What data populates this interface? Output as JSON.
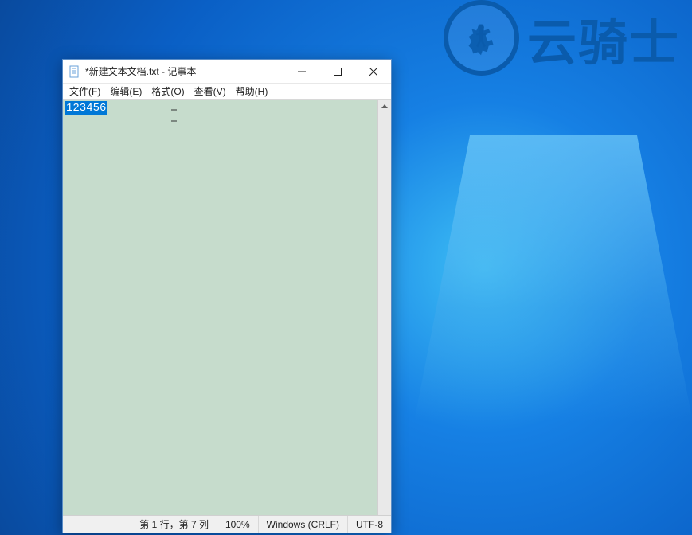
{
  "watermark": {
    "text": "云骑士"
  },
  "window": {
    "title": "*新建文本文档.txt - 记事本"
  },
  "menubar": {
    "file": "文件(F)",
    "edit": "编辑(E)",
    "format": "格式(O)",
    "view": "查看(V)",
    "help": "帮助(H)"
  },
  "editor": {
    "selected_text": "123456"
  },
  "statusbar": {
    "position": "第 1 行，第 7 列",
    "zoom": "100%",
    "line_ending": "Windows (CRLF)",
    "encoding": "UTF-8"
  }
}
